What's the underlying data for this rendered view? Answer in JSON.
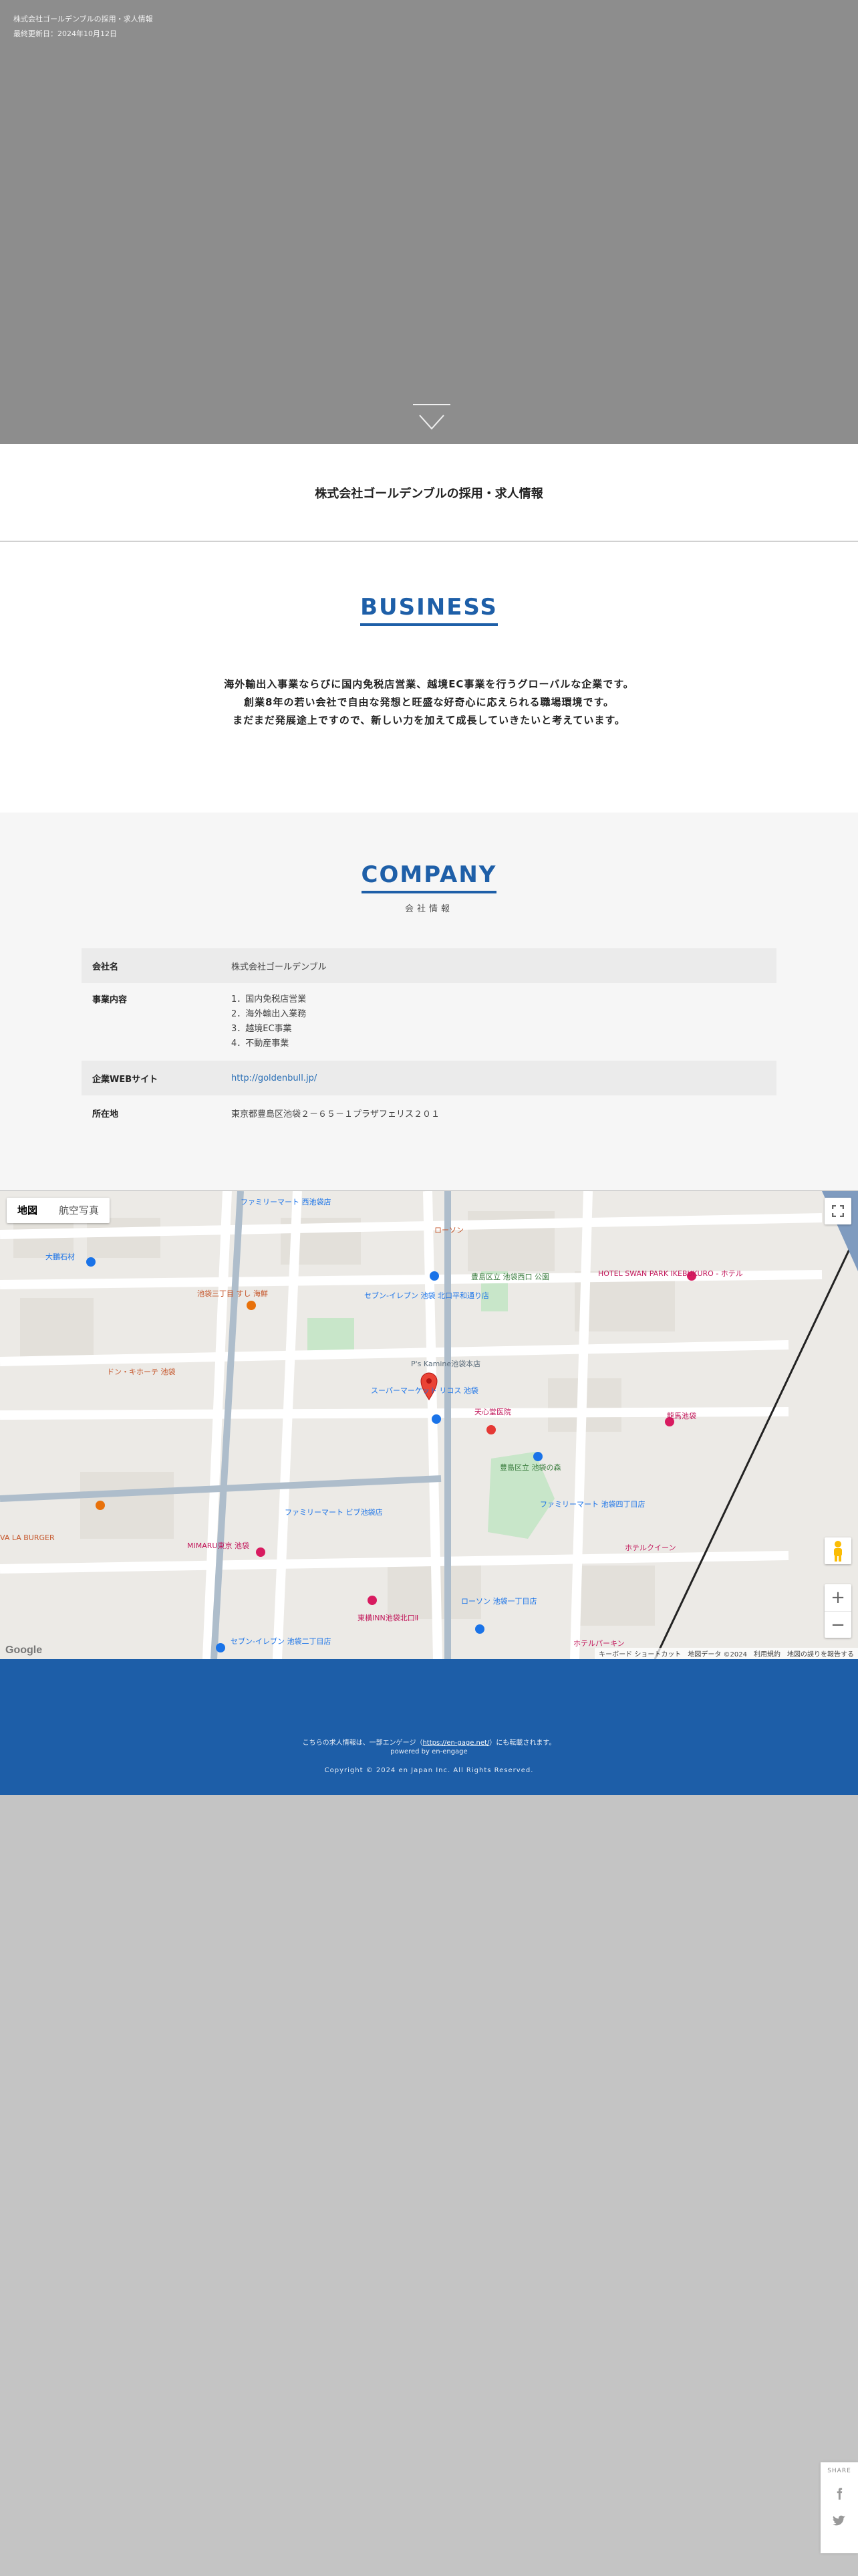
{
  "hero": {
    "breadcrumb": "株式会社ゴールデンブルの採用・求人情報",
    "updated": "最終更新日：2024年10月12日"
  },
  "title_band": {
    "title": "株式会社ゴールデンブルの採用・求人情報"
  },
  "business": {
    "heading": "BUSINESS",
    "lines": [
      "海外輸出入事業ならびに国内免税店営業、越境EC事業を行うグローバルな企業です。",
      "創業8年の若い会社で自由な発想と旺盛な好奇心に応えられる職場環境です。",
      "まだまだ発展途上ですので、新しい力を加えて成長していきたいと考えています。"
    ]
  },
  "company": {
    "heading": "COMPANY",
    "subheading": "会社情報",
    "rows": {
      "name_label": "会社名",
      "name_value": "株式会社ゴールデンブル",
      "business_label": "事業内容",
      "business_items": [
        "1．国内免税店営業",
        "2．海外輸出入業務",
        "3．越境EC事業",
        "4．不動産事業"
      ],
      "web_label": "企業WEBサイト",
      "web_value": "http://goldenbull.jp/",
      "address_label": "所在地",
      "address_value": "東京都豊島区池袋２－６５－１プラザフェリス２０１"
    }
  },
  "map": {
    "tab_map": "地図",
    "tab_satellite": "航空写真",
    "labels": {
      "family_nishi": "ファミリーマート 西池袋店",
      "lawson": "ローソン",
      "daiko": "大鵬石材",
      "swan_park": "HOTEL SWAN PARK IKEBUKURO - ホテル",
      "park": "豊島区立 池袋西口 公園",
      "seven_nishi": "セブン-イレブン 池袋 北口平和通り店",
      "sushi": "池袋三丁目 すし 海鮮",
      "kamiike": "P's Kamine池袋本店",
      "super": "スーパーマーケット リコス 池袋",
      "tenchu": "天心堂医院",
      "hotel_queen": "ホテルクイーン",
      "toshima_mori": "豊島区立 池袋の森",
      "family_4": "ファミリーマート 池袋四丁目店",
      "rokyu": "龍馬池袋",
      "family_bq": "ファミリーマート ビブ池袋店",
      "mimaru": "MIMARU東京 池袋",
      "tokyu_inn": "東横INN池袋北口Ⅱ",
      "lawson_1": "ローソン 池袋一丁目店",
      "seven_1": "セブン-イレブン 池袋二丁目店",
      "hotel_pacchi": "ホテルパーキン",
      "donki": "ドン・キホーテ 池袋",
      "lalaburger": "VA LA BURGER",
      "footer_keys": "キーボード ショートカット",
      "footer_data": "地図データ ©2024",
      "footer_terms": "利用規約",
      "footer_report": "地図の誤りを報告する",
      "google": "Google"
    },
    "pin_color": "#ea4335"
  },
  "footer": {
    "prefix": "こちらの求人情報は、一部エンゲージ（",
    "link": "https://en-gage.net/",
    "suffix": "）にも転載されます。",
    "powered": "powered by en-engage",
    "copyright": "Copyright © 2024 en Japan Inc. All Rights Reserved."
  },
  "share": {
    "label": "SHARE",
    "icons": [
      "facebook-icon",
      "twitter-icon"
    ]
  },
  "colors": {
    "accent": "#1e5fa8",
    "hero_bg": "#8d8d8d",
    "page_bg": "#c4c4c4"
  }
}
